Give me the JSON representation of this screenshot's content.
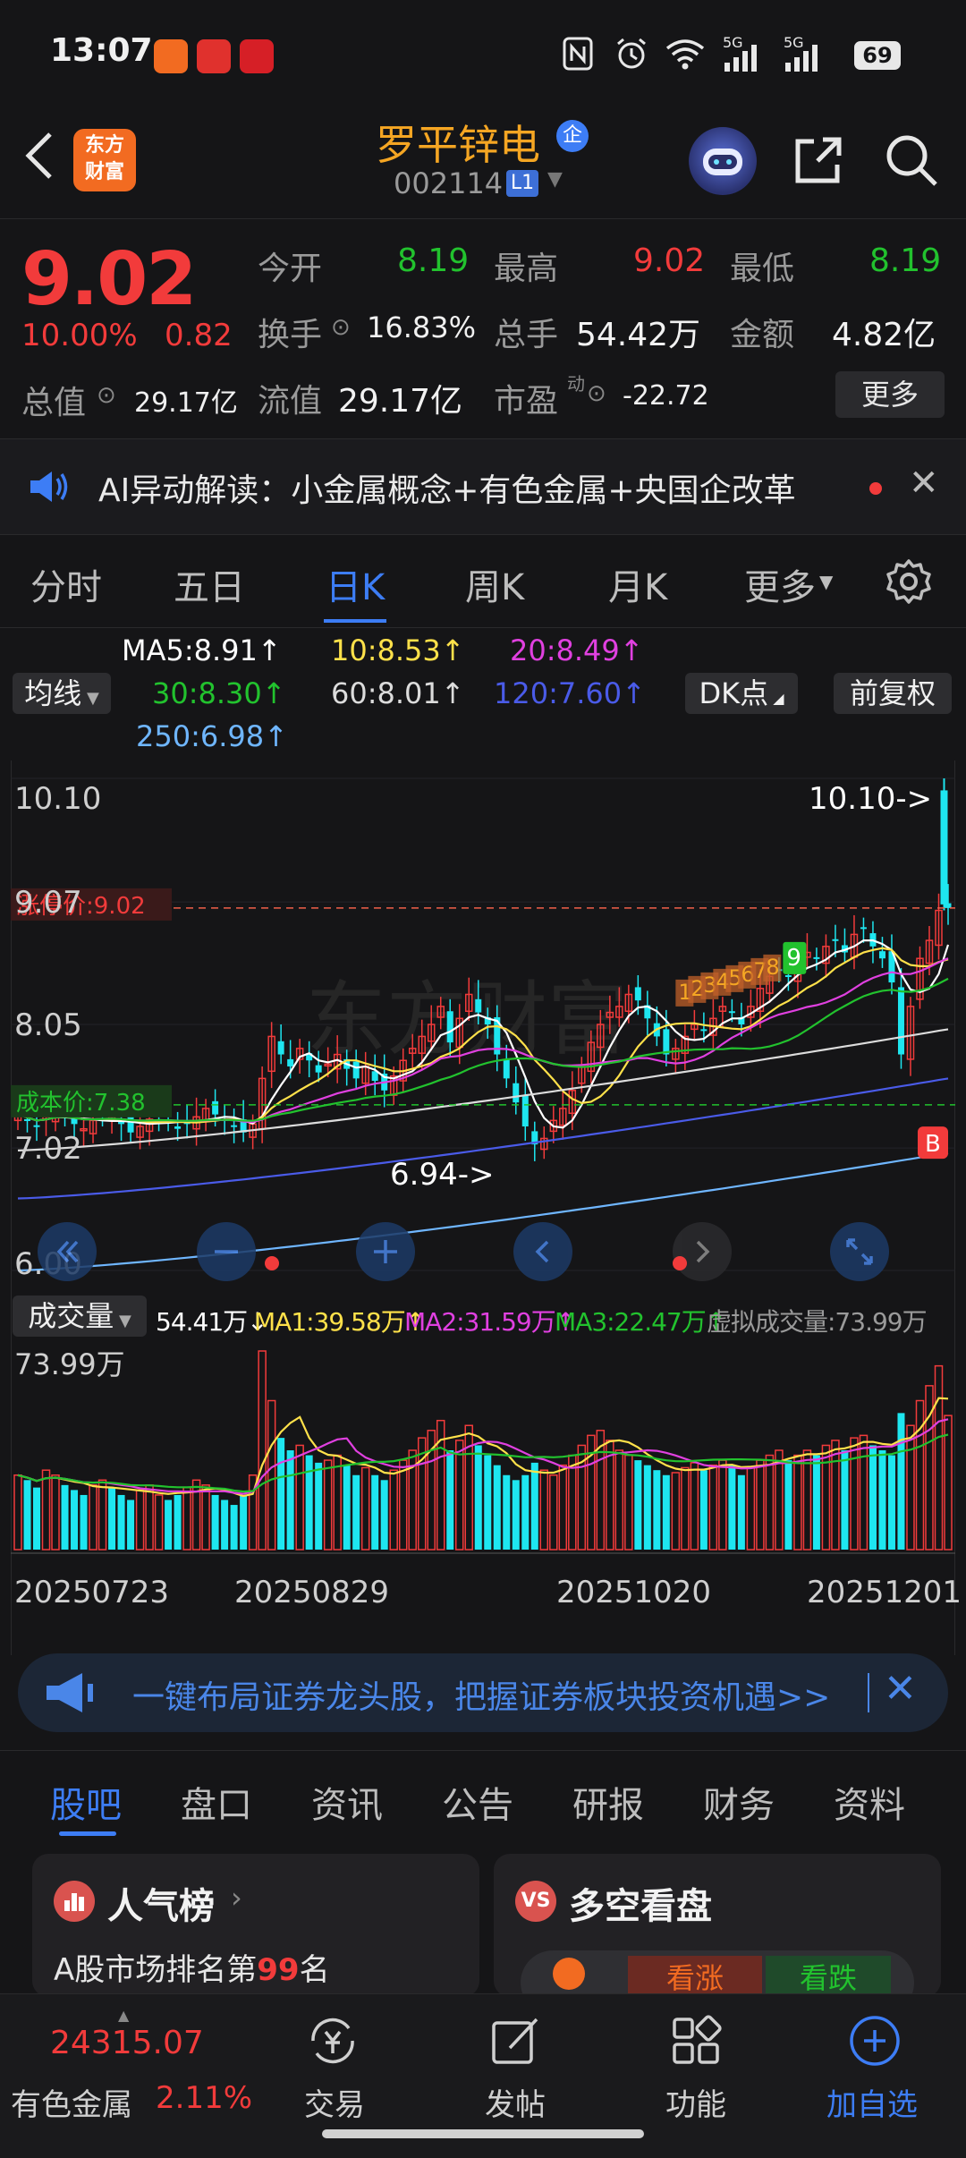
{
  "status_bar": {
    "time": "13:07",
    "battery": "69",
    "network_labels": [
      "5G",
      "5G"
    ],
    "icons": [
      "app-icon-orange",
      "app-icon-red",
      "app-icon-cmb",
      "nfc-icon",
      "alarm-icon",
      "wifi-icon",
      "signal-icon",
      "signal-icon",
      "battery-icon"
    ]
  },
  "header": {
    "logo_line1": "东方",
    "logo_line2": "财富",
    "stock_name": "罗平锌电",
    "enterprise_badge": "企",
    "stock_code": "002114",
    "level_badge": "L1",
    "icons": [
      "back-icon",
      "robot-assistant-icon",
      "share-icon",
      "search-icon"
    ]
  },
  "quote": {
    "price": "9.02",
    "change_pct": "10.00%",
    "change_abs": "0.82",
    "open_label": "今开",
    "open": "8.19",
    "high_label": "最高",
    "high": "9.02",
    "low_label": "最低",
    "low": "8.19",
    "turnover_label": "换手",
    "turnover": "16.83%",
    "volume_label": "总手",
    "volume": "54.42万",
    "amount_label": "金额",
    "amount": "4.82亿",
    "mktcap_label": "总值",
    "mktcap": "29.17亿",
    "float_label": "流值",
    "float_cap": "29.17亿",
    "pe_label": "市盈",
    "pe_sup": "动",
    "pe": "-22.72",
    "more_label": "更多",
    "colors": {
      "up": "#f23b3b",
      "down": "#22c22e"
    }
  },
  "ai_banner": {
    "text": "AI异动解读：小金属概念+有色金属+央国企改革"
  },
  "period_tabs": {
    "items": [
      "分时",
      "五日",
      "日K",
      "周K",
      "月K",
      "更多"
    ],
    "active": "日K"
  },
  "ma_legend": {
    "selector": "均线",
    "ma5": "MA5:8.91↑",
    "ma10": "10:8.53↑",
    "ma20": "20:8.49↑",
    "ma30": "30:8.30↑",
    "ma60": "60:8.01↑",
    "ma120": "120:7.60↑",
    "ma250": "250:6.98↑",
    "dk_label": "DK点",
    "adjust_label": "前复权",
    "colors": {
      "ma5": "#ffffff",
      "ma10": "#ffe14a",
      "ma20": "#e040e0",
      "ma30": "#22c22e",
      "ma60": "#dcdcdc",
      "ma120": "#4a5be8",
      "ma250": "#6fb6ff"
    }
  },
  "chart_data": {
    "type": "candlestick",
    "y_labels": [
      "10.10",
      "9.07",
      "8.05",
      "7.02",
      "6.00"
    ],
    "ylim": [
      6.0,
      10.1
    ],
    "limit_up_label": "涨停价:9.02",
    "limit_up": 9.02,
    "cost_label": "成本价:7.38",
    "cost": 7.38,
    "high_annotation": "10.10->",
    "low_annotation": "6.94->",
    "buy_marker": "B",
    "dk_markers": [
      "1",
      "2",
      "3",
      "4",
      "5",
      "6",
      "7",
      "8",
      "9"
    ],
    "watermark": "东方财富",
    "x_labels": [
      "20250723",
      "20250829",
      "20251020",
      "20251201"
    ],
    "close": [
      7.3,
      7.25,
      7.2,
      7.28,
      7.35,
      7.3,
      7.22,
      7.18,
      7.25,
      7.3,
      7.28,
      7.22,
      7.15,
      7.2,
      7.26,
      7.3,
      7.24,
      7.18,
      7.22,
      7.28,
      7.35,
      7.3,
      7.25,
      7.2,
      7.15,
      7.22,
      7.6,
      7.95,
      7.8,
      7.7,
      7.85,
      7.75,
      7.65,
      7.72,
      7.8,
      7.68,
      7.6,
      7.7,
      7.58,
      7.5,
      7.62,
      7.75,
      7.85,
      7.95,
      8.05,
      8.2,
      7.9,
      8.1,
      8.3,
      8.15,
      8.05,
      7.8,
      7.6,
      7.4,
      7.2,
      7.05,
      7.1,
      7.25,
      7.35,
      7.5,
      7.7,
      7.9,
      8.05,
      8.15,
      8.2,
      8.3,
      8.25,
      8.1,
      7.95,
      7.8,
      7.85,
      7.95,
      8.05,
      8.0,
      8.1,
      8.2,
      8.15,
      8.05,
      8.2,
      8.35,
      8.45,
      8.5,
      8.45,
      8.55,
      8.65,
      8.6,
      8.7,
      8.75,
      8.65,
      8.8,
      8.85,
      8.7,
      8.6,
      8.4,
      7.8,
      8.2,
      8.6,
      8.75,
      9.0,
      9.02
    ],
    "volume_y_label": "73.99万",
    "volume": [
      30,
      28,
      25,
      32,
      30,
      26,
      24,
      22,
      26,
      28,
      25,
      22,
      20,
      24,
      26,
      22,
      20,
      22,
      25,
      28,
      26,
      22,
      20,
      18,
      22,
      30,
      80,
      60,
      45,
      40,
      42,
      38,
      35,
      36,
      38,
      34,
      30,
      33,
      30,
      28,
      32,
      36,
      40,
      45,
      48,
      52,
      40,
      44,
      50,
      42,
      38,
      34,
      30,
      28,
      30,
      35,
      32,
      30,
      34,
      38,
      42,
      46,
      48,
      44,
      40,
      38,
      36,
      34,
      32,
      30,
      31,
      33,
      35,
      32,
      34,
      36,
      34,
      30,
      33,
      36,
      38,
      40,
      36,
      38,
      40,
      38,
      42,
      44,
      40,
      45,
      46,
      42,
      40,
      38,
      55,
      50,
      60,
      66,
      74,
      54
    ]
  },
  "volume_legend": {
    "selector": "成交量",
    "vol": "54.41万↓",
    "ma1": "MA1:39.58万↑",
    "ma2": "MA2:31.59万↑",
    "ma3": "MA3:22.47万↑",
    "virtual": "虚拟成交量:73.99万",
    "colors": {
      "ma1": "#ffe14a",
      "ma2": "#e040e0",
      "ma3": "#22c22e"
    }
  },
  "chart_controls": [
    "rewind-icon",
    "zoom-out-icon",
    "zoom-in-icon",
    "prev-icon",
    "next-icon",
    "expand-icon"
  ],
  "promo": {
    "text": "一键布局证券龙头股，把握证券板块投资机遇>>"
  },
  "content_tabs": {
    "items": [
      "股吧",
      "盘口",
      "资讯",
      "公告",
      "研报",
      "财务",
      "资料"
    ],
    "active": "股吧"
  },
  "cards": {
    "popularity_title": "人气榜",
    "popularity_text_prefix": "A股市场排名第",
    "popularity_rank": "99",
    "popularity_text_suffix": "名",
    "bull_bear_title": "多空看盘",
    "bull_label": "看涨",
    "bear_label": "看跌"
  },
  "bottom_bar": {
    "index_value": "24315.07",
    "sector_name": "有色金属",
    "sector_change": "2.11%",
    "trade_label": "交易",
    "post_label": "发帖",
    "func_label": "功能",
    "add_label": "加自选"
  }
}
